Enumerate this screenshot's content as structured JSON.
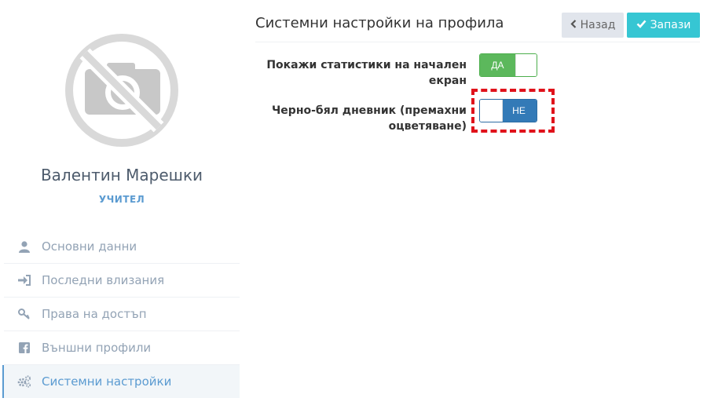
{
  "user": {
    "name": "Валентин Марешки",
    "role": "УЧИТЕЛ",
    "avatar_icon": "no-photo-icon"
  },
  "menu": {
    "items": [
      {
        "label": "Основни данни",
        "icon": "user-icon",
        "active": false
      },
      {
        "label": "Последни влизания",
        "icon": "sign-in-icon",
        "active": false
      },
      {
        "label": "Права на достъп",
        "icon": "key-icon",
        "active": false
      },
      {
        "label": "Външни профили",
        "icon": "facebook-icon",
        "active": false
      },
      {
        "label": "Системни настройки",
        "icon": "cogs-icon",
        "active": true
      }
    ]
  },
  "main": {
    "title": "Системни настройки на профила",
    "back_button": "Назад",
    "save_button": "Запази",
    "settings": [
      {
        "label_line1": "Покажи статистики на начален",
        "label_line2": "екран",
        "toggle_state": "on",
        "on_text": "ДА"
      },
      {
        "label_line1": "Черно-бял дневник (премахни",
        "label_line2": "оцветяване)",
        "toggle_state": "off",
        "off_text": "НЕ"
      }
    ]
  },
  "colors": {
    "accent_blue": "#5b9bd1",
    "save_green": "#36c6d3",
    "toggle_on": "#5cb85c",
    "toggle_off": "#337ab7",
    "highlight_red": "#e0121b"
  }
}
